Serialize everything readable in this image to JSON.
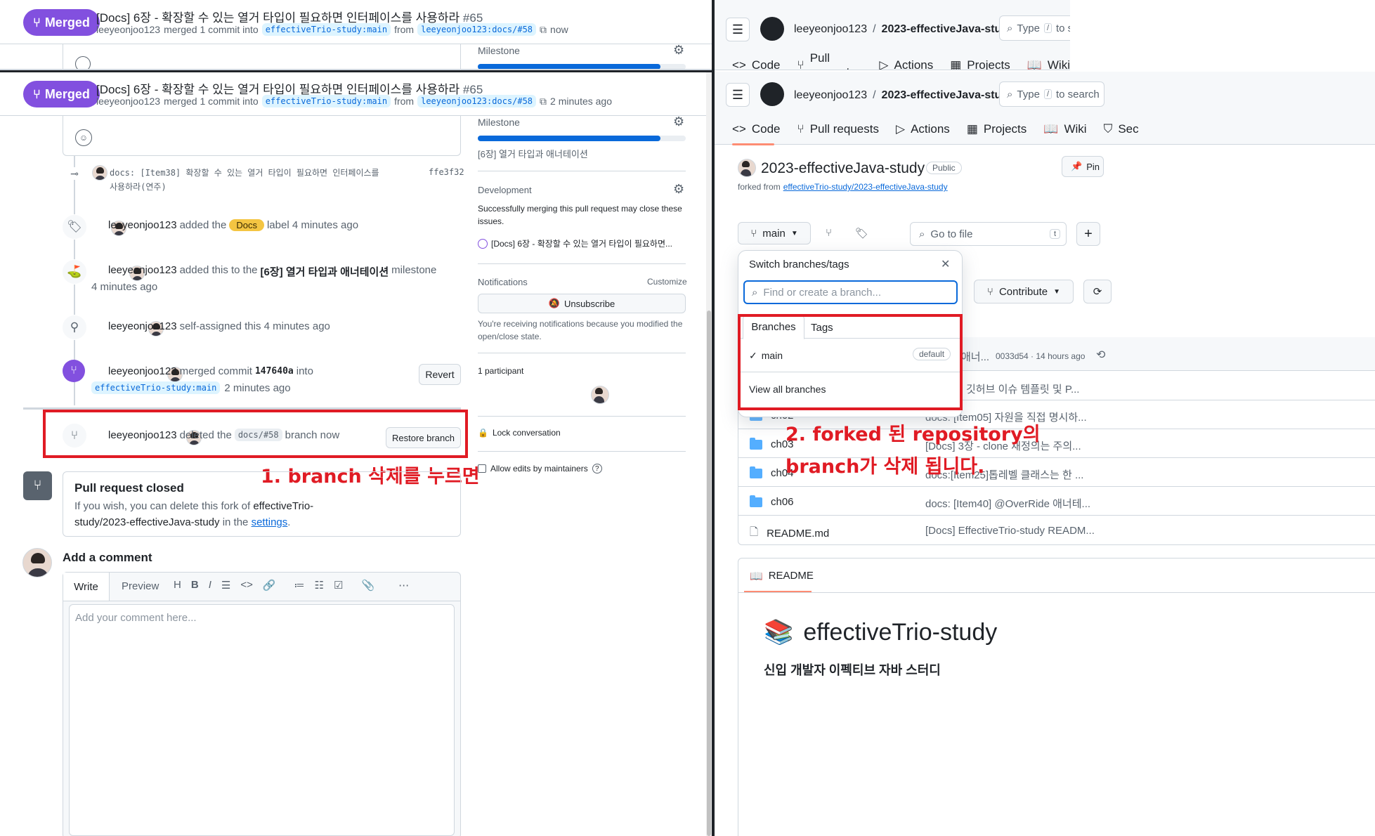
{
  "left_top": {
    "status": "Merged",
    "title": "[Docs] 6장 - 확장할 수 있는 열거 타입이 필요하면 인터페이스를 사용하라",
    "number": "#65",
    "author": "leeyeonjoo123",
    "merged_text": "merged 1 commit into",
    "base_branch": "effectiveTrio-study:main",
    "from": "from",
    "head_branch": "leeyeonjoo123:docs/#58",
    "time": "now",
    "milestone_label": "Milestone"
  },
  "left": {
    "status": "Merged",
    "title": "[Docs] 6장 - 확장할 수 있는 열거 타입이 필요하면 인터페이스를 사용하라",
    "number": "#65",
    "author": "leeyeonjoo123",
    "merged_text": "merged 1 commit into",
    "base_branch": "effectiveTrio-study:main",
    "from": "from",
    "head_branch": "leeyeonjoo123:docs/#58",
    "time": "2 minutes ago"
  },
  "timeline": {
    "commit_msg_1": "docs: [Item38] 확장할 수 있는 열거 타입이 필요하면 인터페이스를",
    "commit_msg_2": "사용하라(연주)",
    "commit_sha": "ffe3f32",
    "label_event": {
      "user": "leeyeonjoo123",
      "pre": "added the",
      "label": "Docs",
      "post": "label 4 minutes ago"
    },
    "milestone_event": {
      "user": "leeyeonjoo123",
      "pre": "added this to the",
      "milestone": "[6장] 열거 타입과 애너테이션",
      "post": "milestone",
      "time": "4 minutes ago"
    },
    "assign_event": {
      "user": "leeyeonjoo123",
      "text": "self-assigned this 4 minutes ago"
    },
    "merge_event": {
      "user": "leeyeonjoo123",
      "pre": "merged commit",
      "sha": "147640a",
      "into": "into",
      "branch": "effectiveTrio-study:main",
      "time": "2 minutes ago",
      "revert": "Revert"
    },
    "delete_event": {
      "user": "leeyeonjoo123",
      "pre": "deleted the",
      "branch": "docs/#58",
      "post": "branch now",
      "restore": "Restore branch"
    },
    "closed": {
      "title": "Pull request closed",
      "line1_pre": "If you wish, you can delete this fork of",
      "line1_bold": "effectiveTrio-",
      "line2_bold": "study/2023-effectiveJava-study",
      "line2_mid": "in the",
      "line2_link": "settings",
      "line2_end": "."
    },
    "add_comment": "Add a comment",
    "tabs": {
      "write": "Write",
      "preview": "Preview"
    },
    "placeholder": "Add your comment here..."
  },
  "sidebar": {
    "milestone_label": "Milestone",
    "milestone_name": "[6장] 열거 타입과 애너테이션",
    "milestone_progress": 0.88,
    "development_label": "Development",
    "development_text": "Successfully merging this pull request may close these issues.",
    "linked_issue": "[Docs] 6장 - 확장할 수 있는 열거 타입이 필요하면...",
    "notifications_label": "Notifications",
    "customize": "Customize",
    "unsubscribe": "Unsubscribe",
    "notif_text": "You're receiving notifications because you modified the open/close state.",
    "participants": "1 participant",
    "lock": "Lock conversation",
    "allow_edits": "Allow edits by maintainers"
  },
  "annotations": {
    "left": "1. branch 삭제를 누르면",
    "right_1": "2. forked 된 repository의",
    "right_2": "branch가 삭제 됩니다."
  },
  "right_top": {
    "owner": "leeyeonjoo123",
    "slash": "/",
    "repo": "2023-effectiveJava-study",
    "search": "Type",
    "search_end": "to s",
    "nav": [
      "Code",
      "Pull requests",
      "Actions",
      "Projects",
      "Wiki"
    ]
  },
  "right": {
    "owner": "leeyeonjoo123",
    "slash": "/",
    "repo": "2023-effectiveJava-study",
    "search": "Type",
    "search_end": "to search",
    "nav": [
      "Code",
      "Pull requests",
      "Actions",
      "Projects",
      "Wiki",
      "Sec"
    ],
    "repo_title": "2023-effectiveJava-study",
    "visibility": "Public",
    "pin": "Pin",
    "forked_from": "forked from",
    "forked_link": "effectiveTrio-study/2023-effectiveJava-study",
    "branch": "main",
    "go_to_file": "Go to file",
    "shortcut": "t",
    "contribute": "Contribute",
    "commit_partial": "애너...",
    "commit_meta": "0033d54 · 14 hours ago",
    "row1_msg": "깃허브 이슈 템플릿 및 P...",
    "files": [
      {
        "name": "ch02",
        "msg": "docs: [Item05] 자원을 직접 명시하..."
      },
      {
        "name": "ch03",
        "msg": "[Docs] 3장 - clone 재정의는 주의..."
      },
      {
        "name": "ch04",
        "msg": "docs:[Item25]톱레벨 클래스는 한 ..."
      },
      {
        "name": "ch06",
        "msg": "docs: [Item40] @OverRide 애너테..."
      },
      {
        "name": "README.md",
        "msg": "[Docs] EffectiveTrio-study READM..."
      }
    ],
    "readme_label": "README",
    "readme_title": "effectiveTrio-study",
    "readme_sub": "신입 개발자 이펙티브 자바 스터디"
  },
  "dropdown": {
    "title": "Switch branches/tags",
    "placeholder": "Find or create a branch...",
    "tabs": [
      "Branches",
      "Tags"
    ],
    "branch": "main",
    "default": "default",
    "view_all": "View all branches"
  }
}
